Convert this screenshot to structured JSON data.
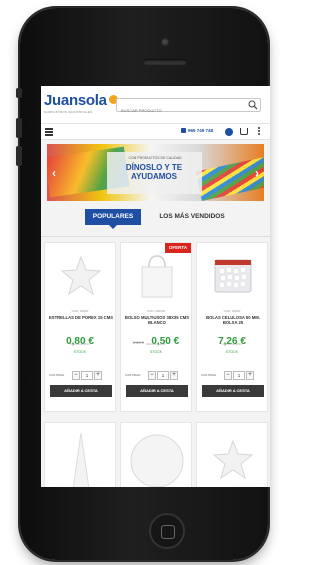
{
  "header": {
    "logo_text_main": "Juan",
    "logo_text_accent": "sola",
    "logo_tagline": "SUMINISTROS INDUSTRIALES",
    "search_placeholder": "BUSCAR PRODUCTO"
  },
  "toolbar": {
    "phone": "966 749 748"
  },
  "banner": {
    "small_text": "CON PRODUCTOS DE CALIDAD",
    "title": "DÍNOSLO Y TE AYUDAMOS"
  },
  "tabs": [
    {
      "label": "POPULARES",
      "active": true
    },
    {
      "label": "LOS MÁS VENDIDOS",
      "active": false
    }
  ],
  "products": [
    {
      "ref": "COD. 00000",
      "name": "ESTRELLAS DE POREX 15 CMS",
      "price": "0,80 €",
      "old_price": "",
      "vat": "IVA INCLUIDO",
      "stock": "STOCK",
      "qty_label": "CANTIDAD",
      "qty": "1",
      "offer": "",
      "button": "AÑADIR A CESTA"
    },
    {
      "ref": "COD. 000000",
      "name": "BOLSO MULTIUSOS 38X35 CMS BLANCO",
      "price": "0,50 €",
      "old_price": "0,60 €",
      "vat": "IVA INCLUIDO",
      "stock": "STOCK",
      "qty_label": "CANTIDAD",
      "qty": "1",
      "offer": "OFERTA",
      "button": "AÑADIR A CESTA"
    },
    {
      "ref": "COD. 00000",
      "name": "BOLAS CELULOSA 50 MM. BOLSA 25",
      "price": "7,26 €",
      "old_price": "",
      "vat": "IVA INCLUIDO",
      "stock": "STOCK",
      "qty_label": "CANTIDAD",
      "qty": "1",
      "offer": "",
      "button": "AÑADIR A CESTA"
    }
  ],
  "colors": {
    "brand_blue": "#1e4fa3",
    "price_green": "#2e9a3a",
    "offer_red": "#d9261c"
  },
  "icons": [
    "search-icon",
    "menu-icon",
    "phone-icon",
    "user-icon",
    "cart-icon",
    "more-icon"
  ]
}
